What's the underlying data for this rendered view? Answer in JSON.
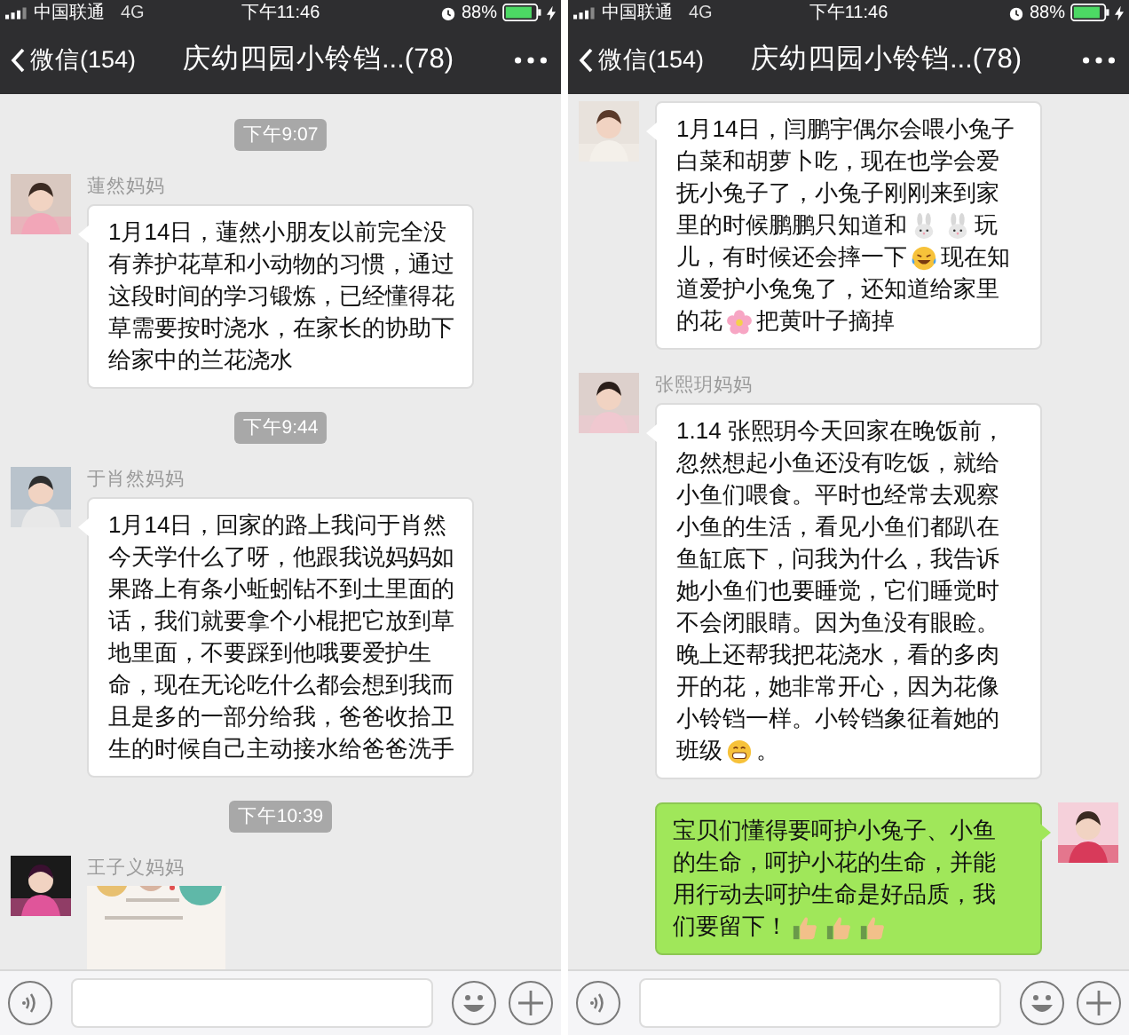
{
  "phones": [
    {
      "status": {
        "carrier": "中国联通",
        "network": "4G",
        "time": "下午11:46",
        "battery": "88%"
      },
      "nav": {
        "back": "微信(154)",
        "title": "庆幼四园小铃铛...(78)"
      },
      "items": [
        {
          "kind": "time",
          "text": "下午9:07"
        },
        {
          "kind": "incoming",
          "sender": "蓮然妈妈",
          "body": [
            {
              "kind": "text",
              "text": "1月14日，蓮然小朋友以前完全没有养护花草和小动物的习惯，通过这段时间的学习锻炼，已经懂得花草需要按时浇水，在家长的协助下给家中的兰花浇水"
            }
          ]
        },
        {
          "kind": "time",
          "text": "下午9:44"
        },
        {
          "kind": "incoming",
          "sender": "于肖然妈妈",
          "body": [
            {
              "kind": "text",
              "text": "1月14日，回家的路上我问于肖然今天学什么了呀，他跟我说妈妈如果路上有条小蚯蚓钻不到土里面的话，我们就要拿个小棍把它放到草地里面，不要踩到他哦要爱护生命，现在无论吃什么都会想到我而且是多的一部分给我，爸爸收拾卫生的时候自己主动接水给爸爸洗手"
            }
          ]
        },
        {
          "kind": "time",
          "text": "下午10:39"
        },
        {
          "kind": "incoming-picture",
          "sender": "王子义妈妈"
        }
      ]
    },
    {
      "status": {
        "carrier": "中国联通",
        "network": "4G",
        "time": "下午11:46",
        "battery": "88%"
      },
      "nav": {
        "back": "微信(154)",
        "title": "庆幼四园小铃铛...(78)"
      },
      "items": [
        {
          "kind": "incoming",
          "lines": [
            [
              {
                "kind": "text",
                "text": "1月14日，闫鹏宇偶尔会喂小兔子"
              }
            ],
            [
              {
                "kind": "text",
                "text": "白菜和胡萝卜吃，现在也学会爱"
              }
            ],
            [
              {
                "kind": "text",
                "text": "抚小兔子了，小兔子刚刚来到家"
              }
            ],
            [
              {
                "kind": "text",
                "text": "里的时候鹏鹏只知道和"
              },
              {
                "kind": "rabbit"
              },
              {
                "kind": "rabbit"
              },
              {
                "kind": "text",
                "text": "玩"
              }
            ],
            [
              {
                "kind": "text",
                "text": "儿，有时候还会摔一下"
              },
              {
                "kind": "laugh-cry"
              },
              {
                "kind": "text",
                "text": "现在知"
              }
            ],
            [
              {
                "kind": "text",
                "text": "道爱护小兔兔了，还知道给家里"
              }
            ],
            [
              {
                "kind": "text",
                "text": "的花"
              },
              {
                "kind": "flower"
              },
              {
                "kind": "text",
                "text": "把黄叶子摘掉"
              }
            ]
          ]
        },
        {
          "kind": "incoming",
          "sender": "张熙玥妈妈",
          "lines": [
            [
              {
                "kind": "text",
                "text": "1.14 张熙玥今天回家在晚饭前，"
              }
            ],
            [
              {
                "kind": "text",
                "text": "忽然想起小鱼还没有吃饭，就给"
              }
            ],
            [
              {
                "kind": "text",
                "text": "小鱼们喂食。平时也经常去观察"
              }
            ],
            [
              {
                "kind": "text",
                "text": "小鱼的生活，看见小鱼们都趴在"
              }
            ],
            [
              {
                "kind": "text",
                "text": "鱼缸底下，问我为什么，我告诉"
              }
            ],
            [
              {
                "kind": "text",
                "text": "她小鱼们也要睡觉，它们睡觉时"
              }
            ],
            [
              {
                "kind": "text",
                "text": "不会闭眼睛。因为鱼没有眼睑。"
              }
            ],
            [
              {
                "kind": "text",
                "text": "晚上还帮我把花浇水，看的多肉"
              }
            ],
            [
              {
                "kind": "text",
                "text": "开的花，她非常开心，因为花像"
              }
            ],
            [
              {
                "kind": "text",
                "text": "小铃铛一样。小铃铛象征着她的"
              }
            ],
            [
              {
                "kind": "text",
                "text": "班级"
              },
              {
                "kind": "grin"
              },
              {
                "kind": "text",
                "text": "。"
              }
            ]
          ]
        },
        {
          "kind": "outgoing",
          "lines": [
            [
              {
                "kind": "text",
                "text": "宝贝们懂得要呵护小兔子、小鱼"
              }
            ],
            [
              {
                "kind": "text",
                "text": "的生命，呵护小花的生命，并能"
              }
            ],
            [
              {
                "kind": "text",
                "text": "用行动去呵护生命是好品质，我"
              }
            ],
            [
              {
                "kind": "text",
                "text": "们要留下！"
              },
              {
                "kind": "thumbs-up"
              },
              {
                "kind": "thumbs-up"
              },
              {
                "kind": "thumbs-up"
              }
            ]
          ]
        }
      ]
    }
  ]
}
